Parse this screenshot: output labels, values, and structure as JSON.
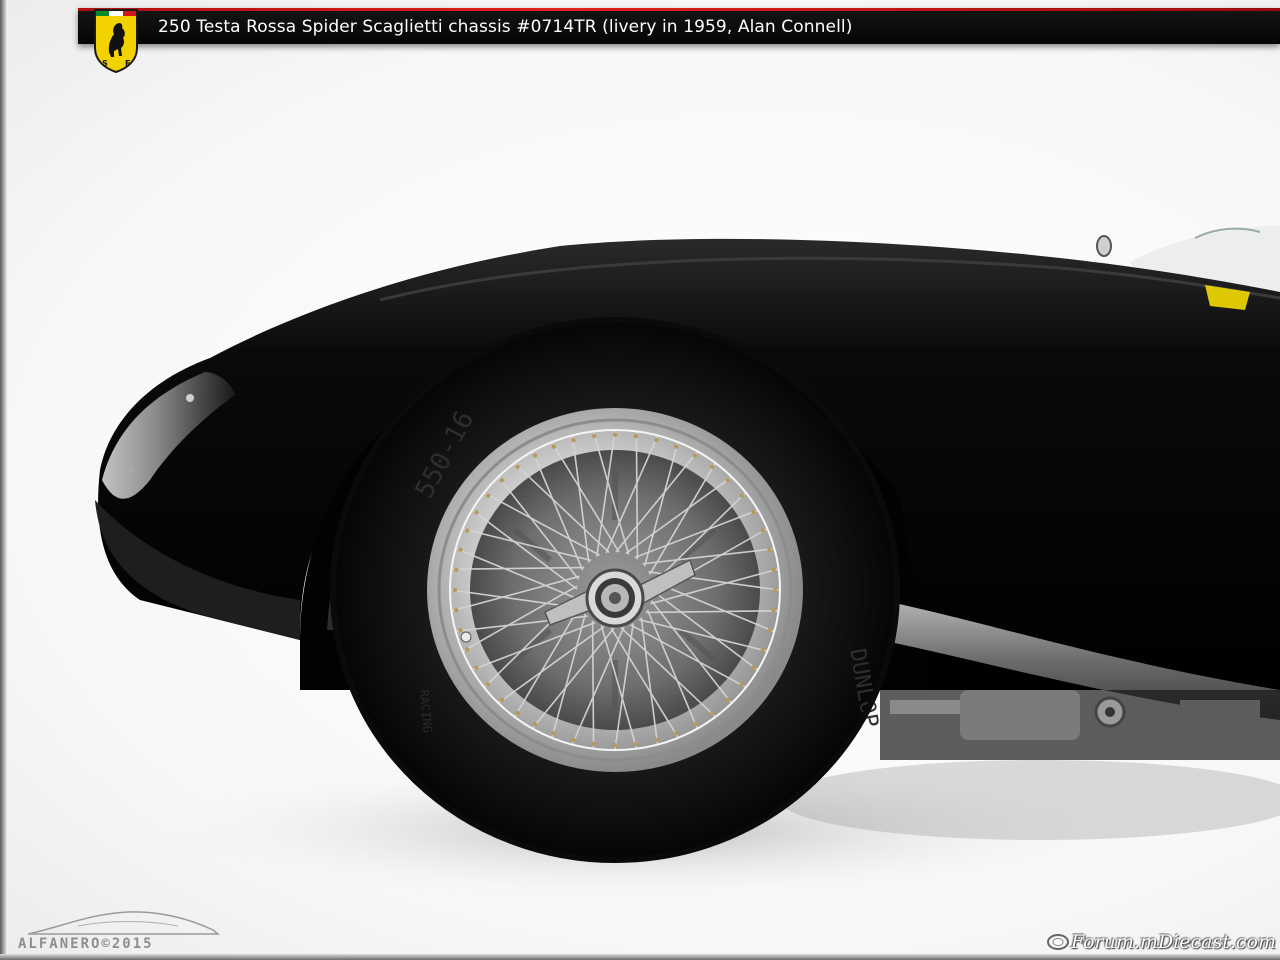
{
  "title": "250 Testa Rossa Spider Scaglietti chassis #0714TR (livery in 1959, Alan Connell)",
  "logo": {
    "icon": "ferrari-prancing-horse-shield-icon"
  },
  "watermarks": {
    "left": "ALFANERO©2015",
    "right": "Forum.mDiecast.com"
  },
  "colors": {
    "title_bar": "#0a0a0a",
    "accent_red": "#d01818",
    "shield_yellow": "#f2d200",
    "car_body": "#050505"
  }
}
